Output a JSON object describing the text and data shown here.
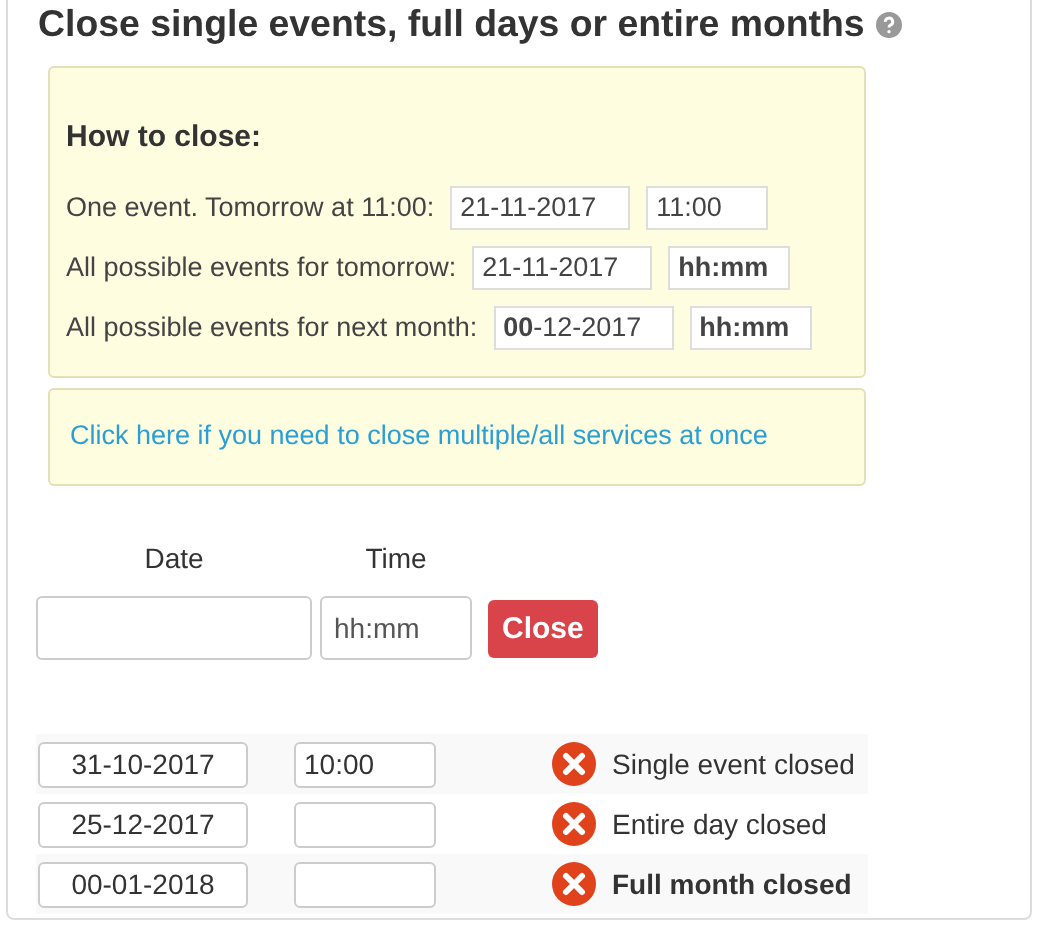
{
  "title": "Close single events, full days or entire months",
  "help": {
    "kind": "help"
  },
  "how_to": {
    "heading": "How to close:",
    "examples": [
      {
        "label": "One event. Tomorrow at 11:00:",
        "date": "21-11-2017",
        "time": "11:00",
        "time_bold": false
      },
      {
        "label": "All possible events for tomorrow:",
        "date": "21-11-2017",
        "time": "hh:mm",
        "time_bold": true
      },
      {
        "label": "All possible events for next month:",
        "date": "**00**-12-2017",
        "time": "hh:mm",
        "time_bold": true
      }
    ]
  },
  "multi_link": "Click here if you need to close multiple/all services at once",
  "form": {
    "date_label": "Date",
    "time_label": "Time",
    "time_placeholder": "hh:mm",
    "button": "Close"
  },
  "closures": [
    {
      "date": "31-10-2017",
      "time": "10:00",
      "status": "Single event closed",
      "kind": "event"
    },
    {
      "date": "25-12-2017",
      "status": "Entire day closed",
      "kind": "day"
    },
    {
      "date": "00-01-2018",
      "status": "Full month closed",
      "kind": "month"
    }
  ]
}
